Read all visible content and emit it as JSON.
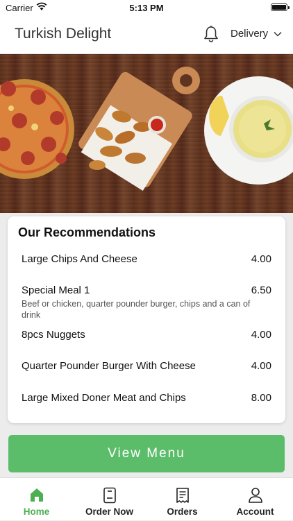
{
  "status_bar": {
    "carrier": "Carrier",
    "time": "5:13 PM"
  },
  "header": {
    "title": "Turkish Delight",
    "delivery_label": "Delivery"
  },
  "recommendations": {
    "title": "Our Recommendations",
    "items": [
      {
        "name": "Large Chips And Cheese",
        "price": "4.00",
        "description": ""
      },
      {
        "name": "Special Meal 1",
        "price": "6.50",
        "description": "Beef or chicken, quarter pounder burger, chips and a can of drink"
      },
      {
        "name": "8pcs Nuggets",
        "price": "4.00",
        "description": ""
      },
      {
        "name": "Quarter Pounder Burger With Cheese",
        "price": "4.00",
        "description": ""
      },
      {
        "name": "Large Mixed Doner Meat and Chips",
        "price": "8.00",
        "description": ""
      }
    ]
  },
  "view_menu_label": "View Menu",
  "tabs": [
    {
      "label": "Home",
      "icon": "home-icon",
      "active": true
    },
    {
      "label": "Order Now",
      "icon": "order-icon",
      "active": false
    },
    {
      "label": "Orders",
      "icon": "receipt-icon",
      "active": false
    },
    {
      "label": "Account",
      "icon": "user-icon",
      "active": false
    }
  ],
  "colors": {
    "accent": "#5bbd6a",
    "active_tab": "#4caf50"
  }
}
